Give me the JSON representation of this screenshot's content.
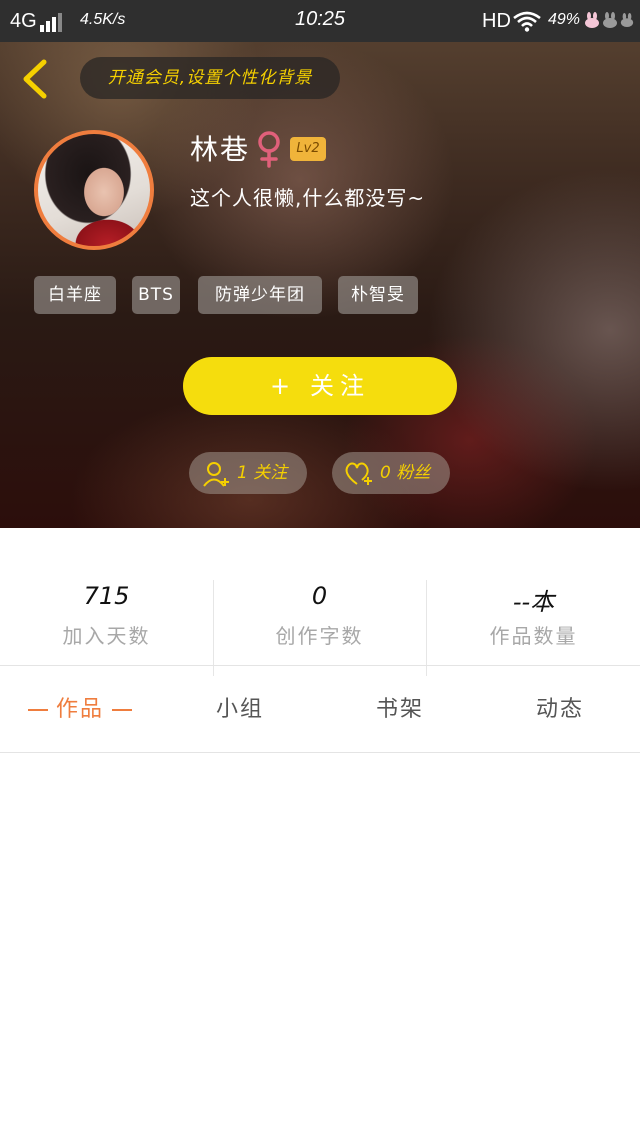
{
  "status_bar": {
    "network": "4G",
    "speed": "4.5K/s",
    "time": "10:25",
    "hd": "HD",
    "battery": "49%"
  },
  "top_bar": {
    "back_icon": "chevron-left-icon",
    "vip_banner": "开通会员,设置个性化背景"
  },
  "profile": {
    "avatar": "user-avatar-photo",
    "name": "林巷",
    "gender_icon": "female-symbol-icon",
    "level": "Lv2",
    "bio": "这个人很懒,什么都没写~",
    "tags": [
      "白羊座",
      "BTS",
      "防弹少年团",
      "朴智旻"
    ]
  },
  "follow_button": {
    "plus": "+",
    "label": "关注"
  },
  "social": {
    "following": {
      "icon": "user-plus-icon",
      "label": "1 关注"
    },
    "fans": {
      "icon": "heart-plus-icon",
      "label": "0 粉丝"
    }
  },
  "stats": [
    {
      "value": "715",
      "label": "加入天数"
    },
    {
      "value": "0",
      "label": "创作字数"
    },
    {
      "value": "--本",
      "label": "作品数量"
    }
  ],
  "tabs": [
    {
      "label": "作品",
      "active": true
    },
    {
      "label": "小组",
      "active": false
    },
    {
      "label": "书架",
      "active": false
    },
    {
      "label": "动态",
      "active": false
    }
  ],
  "colors": {
    "accent_orange": "#ef7d3e",
    "follow_yellow": "#f5dd0d",
    "vip_text_yellow": "#f5d000",
    "level_badge": "#f0b43a",
    "female_pink": "#e0607a"
  }
}
